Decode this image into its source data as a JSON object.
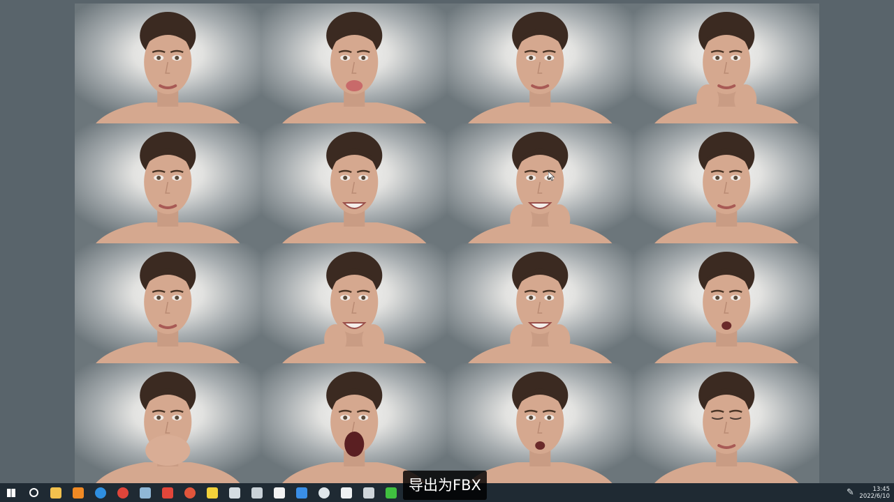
{
  "caption": {
    "text": "导出为FBX"
  },
  "grid": {
    "tiles": [
      {
        "expression": "neutral"
      },
      {
        "expression": "tongue-out"
      },
      {
        "expression": "scrunched"
      },
      {
        "expression": "hands-on-cheeks"
      },
      {
        "expression": "pursed-lips"
      },
      {
        "expression": "grimace"
      },
      {
        "expression": "hands-together-smile"
      },
      {
        "expression": "tongue-side"
      },
      {
        "expression": "angry-stare"
      },
      {
        "expression": "big-smile"
      },
      {
        "expression": "fingers-stretching-mouth"
      },
      {
        "expression": "talking"
      },
      {
        "expression": "hands-over-mouth"
      },
      {
        "expression": "screaming"
      },
      {
        "expression": "surprised"
      },
      {
        "expression": "eyes-closed-kiss"
      }
    ]
  },
  "taskbar": {
    "icons": [
      {
        "name": "windows-start-icon",
        "color": "#ffffff"
      },
      {
        "name": "search-icon",
        "color": "#ffffff"
      },
      {
        "name": "file-explorer-icon",
        "color": "#f2c14e"
      },
      {
        "name": "search-tool-icon",
        "color": "#f08a24"
      },
      {
        "name": "edge-browser-icon",
        "color": "#2f8fe0"
      },
      {
        "name": "chrome-browser-icon",
        "color": "#e0453a"
      },
      {
        "name": "paint-app-icon",
        "color": "#8fb7d6"
      },
      {
        "name": "presentation-app-icon",
        "color": "#e2463a"
      },
      {
        "name": "vivaldi-browser-icon",
        "color": "#e2553b"
      },
      {
        "name": "sticky-notes-icon",
        "color": "#f3d23a"
      },
      {
        "name": "screen-recorder-icon",
        "color": "#d5dde2"
      },
      {
        "name": "image-tool-icon",
        "color": "#c9d2d8"
      },
      {
        "name": "notion-app-icon",
        "color": "#f2f2f2"
      },
      {
        "name": "feather-app-icon",
        "color": "#3a8ee6"
      },
      {
        "name": "circle-app-icon",
        "color": "#dfe6ea"
      },
      {
        "name": "unreal-engine-icon",
        "color": "#eef1f3"
      },
      {
        "name": "zbrush-app-icon",
        "color": "#cfd6db"
      },
      {
        "name": "green-app-icon",
        "color": "#40c040"
      }
    ],
    "tray": {
      "pen_icon": "pen-icon"
    },
    "clock": {
      "time": "13:45",
      "date": "2022/6/10"
    }
  },
  "colors": {
    "background": "#59646b",
    "taskbar": "#1f2a33",
    "skin": "#d5a88f",
    "hair": "#3b2a21"
  }
}
